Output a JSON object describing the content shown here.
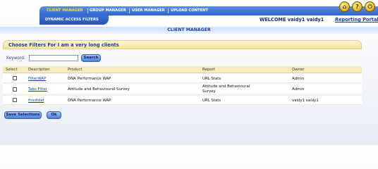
{
  "nav": {
    "items": [
      "CLIENT MANAGER",
      "GROUP MANAGER",
      "USER MANAGER",
      "UPLOAD CONTENT"
    ],
    "sub_item": "DYNAMIC ACCESS FILTERS"
  },
  "header": {
    "icons": [
      "home-icon",
      "help-icon",
      "logout-icon"
    ],
    "welcome": "WELCOME vaidy1 vaidy1",
    "portal_link": "Reporting Portal"
  },
  "page": {
    "title": "CLIENT MANAGER",
    "filter_heading": "Choose Filters For I am a very long clients"
  },
  "search": {
    "label": "Keyword:",
    "value": "",
    "button": "Search"
  },
  "table": {
    "headers": [
      "Select",
      "Description",
      "Product",
      "Report",
      "Owner"
    ],
    "rows": [
      {
        "description": "FilterWAP",
        "product": "DNA Performance WAP",
        "report": "URL Stats",
        "owner": "Admin"
      },
      {
        "description": "Tabs Filter",
        "product": "Attitude and Behavioural Survey",
        "report_line1": "Attitude and Behavioural",
        "report_line2": "Survey",
        "owner": "Admin"
      },
      {
        "description": "firsdtdaf",
        "product": "DNA Performance WAP",
        "report": "URL Stats",
        "owner": "vaidy1 vaidy1"
      }
    ]
  },
  "actions": {
    "save": "Save Selections",
    "ok": "Ok"
  }
}
